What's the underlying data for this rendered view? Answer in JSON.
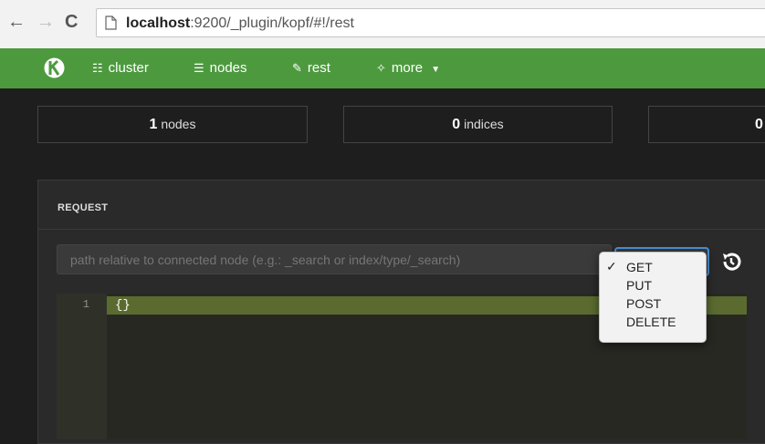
{
  "browser": {
    "url_host": "localhost",
    "url_rest": ":9200/_plugin/kopf/#!/rest",
    "back_icon": "arrow-left-icon",
    "forward_icon": "arrow-right-icon",
    "reload_icon": "reload-icon",
    "page_icon": "page-icon"
  },
  "nav": {
    "brand_icon": "kopf-logo",
    "items": [
      {
        "label": "cluster",
        "icon": "sitemap-icon"
      },
      {
        "label": "nodes",
        "icon": "list-icon"
      },
      {
        "label": "rest",
        "icon": "edit-icon"
      },
      {
        "label": "more",
        "icon": "magic-wand-icon"
      }
    ],
    "accent": "#4d9a3e"
  },
  "stats": [
    {
      "count": "1",
      "label": "nodes"
    },
    {
      "count": "0",
      "label": "indices"
    },
    {
      "count": "0",
      "label": ""
    }
  ],
  "request": {
    "title": "REQUEST",
    "path_placeholder": "path relative to connected node (e.g.: _search or index/type/_search)",
    "method_selected": "GET",
    "methods": [
      "GET",
      "PUT",
      "POST",
      "DELETE"
    ],
    "history_icon": "history-icon",
    "editor": {
      "line_number": "1",
      "content": "{}"
    }
  }
}
